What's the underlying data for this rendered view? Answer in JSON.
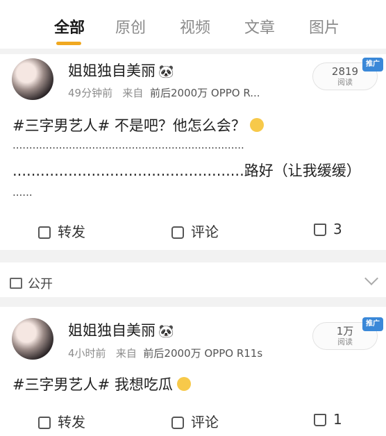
{
  "tabs": [
    "全部",
    "原创",
    "视频",
    "文章",
    "图片"
  ],
  "colors": {
    "accent": "#f0a820",
    "promo": "#3a88d8"
  },
  "posts": [
    {
      "author": "姐姐独自美丽",
      "author_icon": "panda-icon",
      "time": "49分钟前",
      "via_label": "来自",
      "source": "前后2000万 OPPO R...",
      "reads_count": "2819",
      "reads_label": "阅读",
      "promo_label": "推广",
      "lines": [
        "#三字男艺人# 不是吧？他怎么会？",
        "......................................................................",
        "..................................................路好（让我缓缓）",
        "......"
      ],
      "emoji": "smile-emoji",
      "repost": "转发",
      "comment": "评论",
      "likes": "3"
    },
    {
      "author": "姐姐独自美丽",
      "author_icon": "panda-icon",
      "time": "4小时前",
      "via_label": "来自",
      "source": "前后2000万 OPPO R11s",
      "reads_count": "1万",
      "reads_label": "阅读",
      "promo_label": "推广",
      "lines": [
        "#三字男艺人# 我想吃瓜"
      ],
      "emoji": "yum-emoji",
      "repost": "转发",
      "comment": "评论",
      "likes": "1"
    }
  ],
  "visibility": "公开"
}
